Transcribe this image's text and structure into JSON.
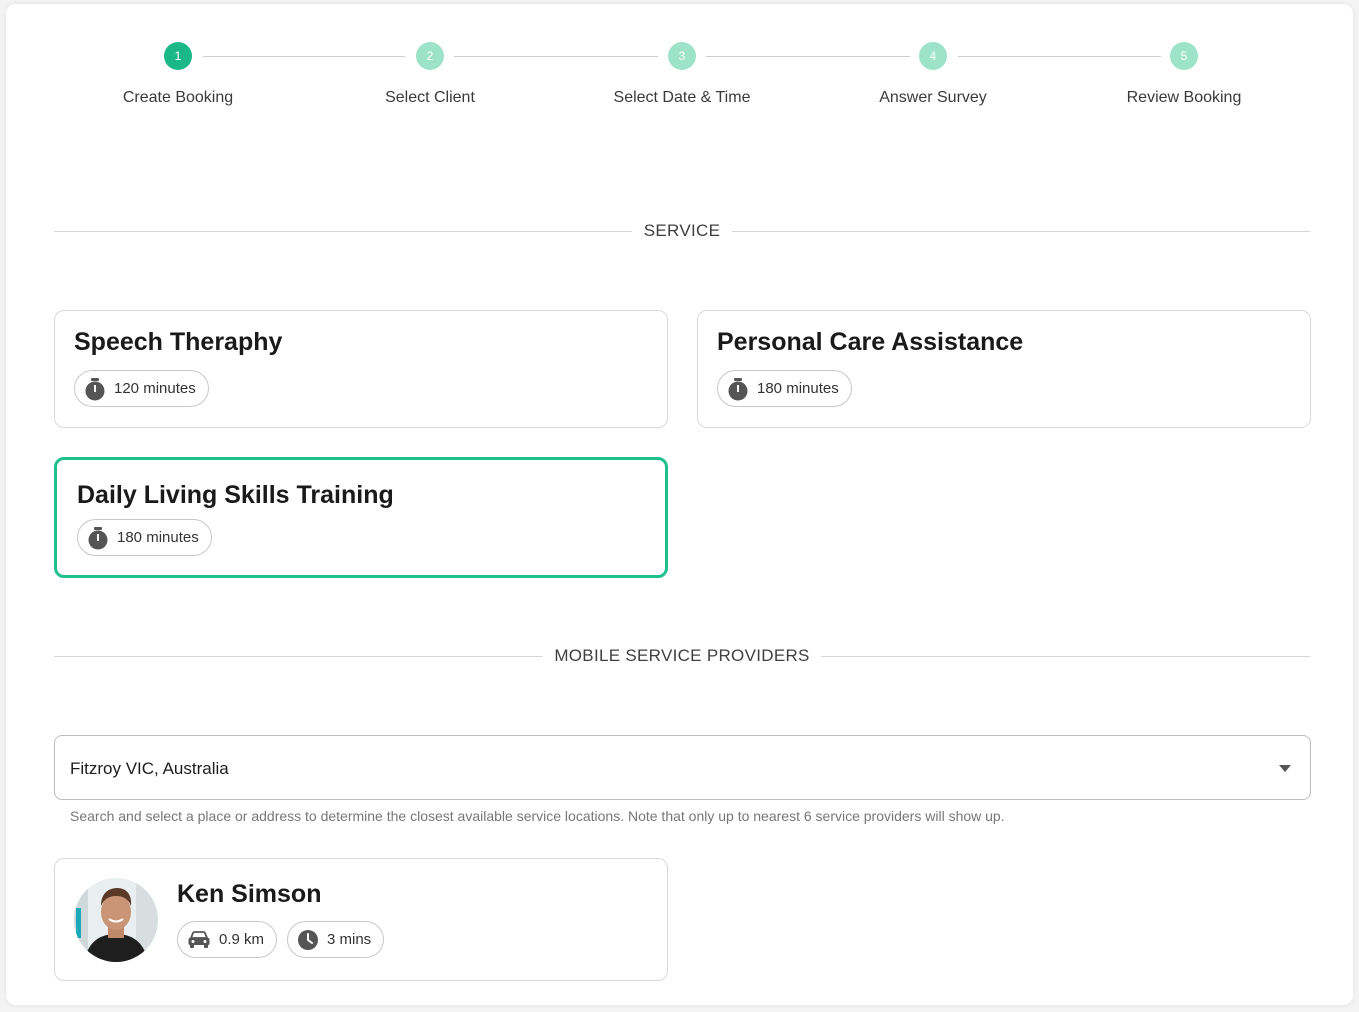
{
  "stepper": {
    "steps": [
      {
        "number": "1",
        "label": "Create Booking",
        "state": "active"
      },
      {
        "number": "2",
        "label": "Select Client",
        "state": "pending"
      },
      {
        "number": "3",
        "label": "Select Date & Time",
        "state": "pending"
      },
      {
        "number": "4",
        "label": "Answer Survey",
        "state": "pending"
      },
      {
        "number": "5",
        "label": "Review Booking",
        "state": "pending"
      }
    ]
  },
  "service_section": {
    "title": "SERVICE",
    "services": [
      {
        "name": "Speech Theraphy",
        "duration": "120 minutes",
        "selected": false
      },
      {
        "name": "Personal Care Assistance",
        "duration": "180 minutes",
        "selected": false
      },
      {
        "name": "Daily Living Skills Training",
        "duration": "180 minutes",
        "selected": true
      }
    ]
  },
  "providers_section": {
    "title": "MOBILE SERVICE PROVIDERS",
    "location": {
      "value": "Fitzroy VIC, Australia",
      "helper": "Search and select a place or address to determine the closest available service locations. Note that only up to nearest 6 service providers will show up."
    },
    "providers": [
      {
        "name": "Ken Simson",
        "distance": "0.9 km",
        "travel_time": "3 mins"
      }
    ]
  },
  "colors": {
    "accent": "#1ab788",
    "accent_light": "#9de3c9",
    "selected_border": "#1fc08e"
  },
  "icons": {
    "duration": "stopwatch-icon",
    "distance": "car-icon",
    "travel_time": "clock-icon",
    "dropdown": "caret-down-icon"
  }
}
